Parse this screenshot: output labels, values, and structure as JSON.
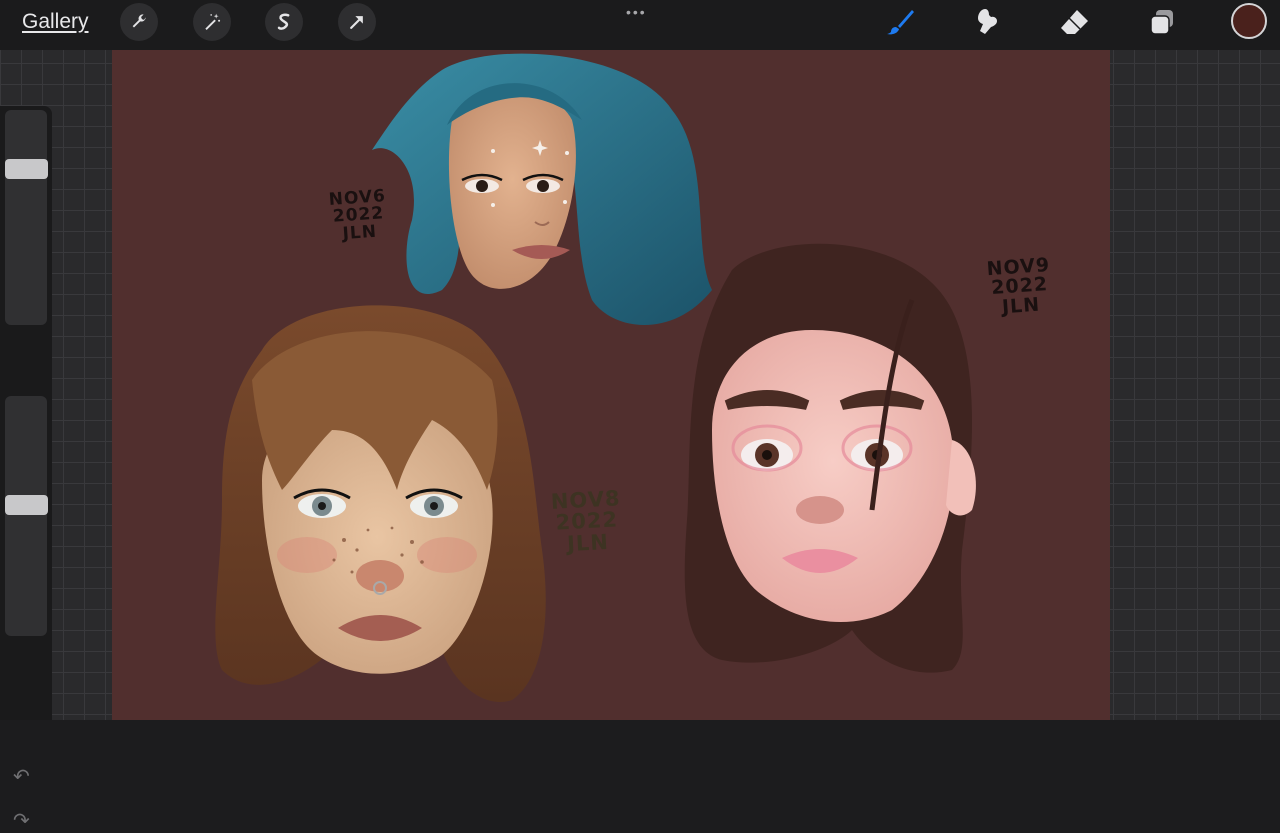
{
  "toolbar": {
    "gallery_label": "Gallery",
    "more_dots": "•••",
    "left_tools": [
      "wrench-icon",
      "magic-wand-icon",
      "selection-icon",
      "transform-arrow-icon"
    ],
    "right_tools": [
      "brush-icon",
      "smudge-icon",
      "eraser-icon",
      "layers-icon"
    ],
    "active_tool": "brush-icon",
    "current_color": "#4a211c",
    "accent_color": "#1e7bf0"
  },
  "sidebar": {
    "brush_size_level": 0.25,
    "opacity_level": 0.45
  },
  "canvas": {
    "background_color": "#512f2e",
    "signatures": [
      {
        "lines": [
          "NOV6",
          "2022",
          "JLN"
        ]
      },
      {
        "lines": [
          "NOV8",
          "2022",
          "JLN"
        ]
      },
      {
        "lines": [
          "NOV9",
          "2022",
          "JLN"
        ]
      }
    ]
  }
}
